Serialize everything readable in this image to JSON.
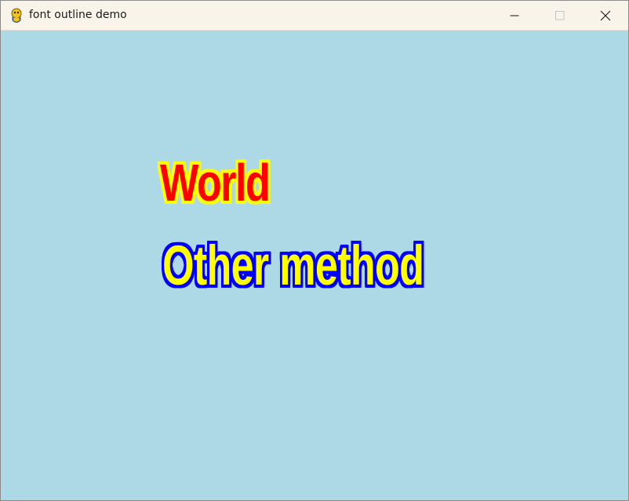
{
  "window": {
    "title": "font outline demo",
    "app_icon": "python-snake-icon",
    "controls": {
      "minimize_icon": "minimize-icon",
      "maximize_icon": "maximize-icon",
      "close_icon": "close-icon"
    }
  },
  "canvas": {
    "background_color": "#add8e6",
    "texts": [
      {
        "text": "World",
        "fill_color": "#ff0000",
        "outline_color": "#ffff00"
      },
      {
        "text": "Other method",
        "fill_color": "#ffff00",
        "outline_color": "#0000ff"
      }
    ]
  }
}
